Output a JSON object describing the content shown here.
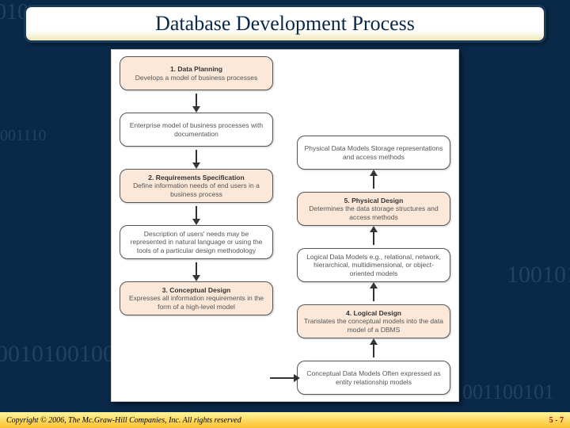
{
  "title": "Database Development Process",
  "footer": {
    "copyright": "Copyright © 2006, The Mc.Graw-Hill Companies, Inc. All rights reserved",
    "page": "5 - 7"
  },
  "diagram": {
    "left": [
      {
        "type": "stage",
        "title": "1. Data Planning",
        "desc": "Develops a model of business processes"
      },
      {
        "type": "output",
        "title": "",
        "desc": "Enterprise model of business processes with documentation"
      },
      {
        "type": "stage",
        "title": "2. Requirements Specification",
        "desc": "Define information needs of end users in a business process"
      },
      {
        "type": "output",
        "title": "",
        "desc": "Description of users' needs may be represented in natural language or using the tools of a particular design methodology"
      },
      {
        "type": "stage",
        "title": "3. Conceptual Design",
        "desc": "Expresses all information requirements in the form of a high-level model"
      }
    ],
    "right": [
      {
        "type": "output",
        "title": "",
        "desc": "Conceptual Data Models Often expressed as entity relationship models"
      },
      {
        "type": "stage",
        "title": "4. Logical Design",
        "desc": "Translates the conceptual models into the data model of a DBMS"
      },
      {
        "type": "output",
        "title": "",
        "desc": "Logical Data Models e.g., relational, network, hierarchical, multidimensional, or object-oriented models"
      },
      {
        "type": "stage",
        "title": "5. Physical Design",
        "desc": "Determines the data storage structures and access methods"
      },
      {
        "type": "output",
        "title": "",
        "desc": "Physical Data Models Storage representations and access methods"
      }
    ]
  }
}
